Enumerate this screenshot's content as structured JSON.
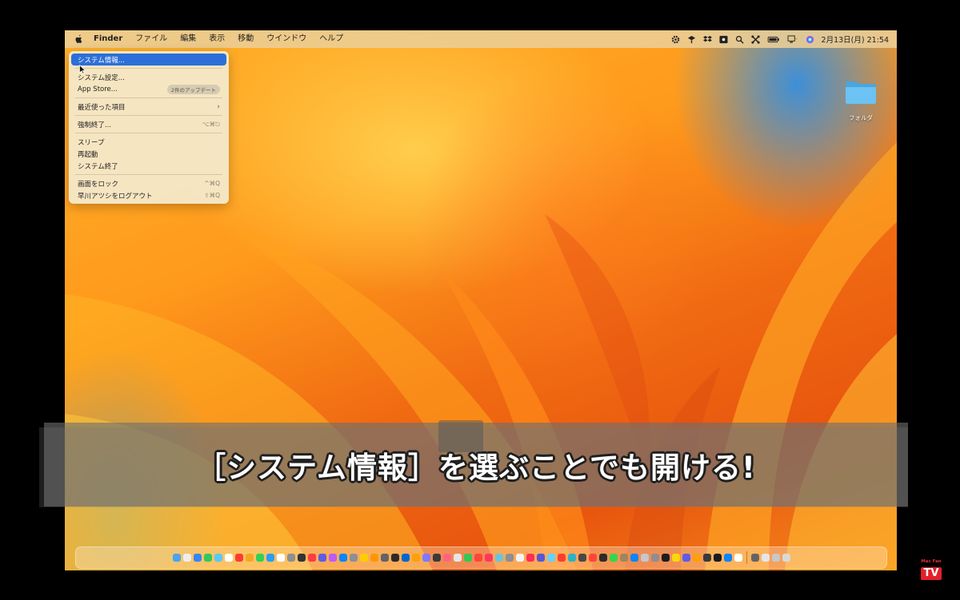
{
  "menubar": {
    "app_name": "Finder",
    "menus": [
      "ファイル",
      "編集",
      "表示",
      "移動",
      "ウインドウ",
      "ヘルプ"
    ],
    "clock": "2月13日(月)  21:54",
    "tray_icons": [
      "gear-icon",
      "network-icon",
      "dropbox-icon",
      "screen-record-icon",
      "search-icon",
      "control-center-icon",
      "battery-icon",
      "display-icon",
      "siri-icon"
    ]
  },
  "apple_menu": {
    "items": [
      {
        "label": "システム情報...",
        "highlighted": true
      },
      {
        "separator": true
      },
      {
        "label": "システム設定..."
      },
      {
        "label": "App Store...",
        "badge": "2件のアップデート"
      },
      {
        "separator": true
      },
      {
        "label": "最近使った項目",
        "submenu": true
      },
      {
        "separator": true
      },
      {
        "label": "強制終了...",
        "shortcut": "⌥⌘⎋"
      },
      {
        "separator": true
      },
      {
        "label": "スリープ"
      },
      {
        "label": "再起動"
      },
      {
        "label": "システム終了"
      },
      {
        "separator": true
      },
      {
        "label": "画面をロック",
        "shortcut": "^⌘Q"
      },
      {
        "label": "早川アツシをログアウト",
        "shortcut": "⇧⌘Q"
      }
    ]
  },
  "desktop": {
    "folder_label": "フォルダ"
  },
  "subtitle": "［システム情報］を選ぶことでも開ける!",
  "logo": {
    "small_text": "Mac Fan",
    "tv_text": "TV"
  },
  "colors": {
    "highlight": "#2d6fd8",
    "folder": "#5bb4ea",
    "logo_red": "#e41f2a"
  },
  "dock": {
    "app_colors": [
      "#4aa3f0",
      "#eeeeee",
      "#3b82f6",
      "#34c759",
      "#5ac8fa",
      "#ffffff",
      "#ff3b30",
      "#f5a623",
      "#30d158",
      "#2a9df4",
      "#ffffff",
      "#8e8e93",
      "#333333",
      "#fc3c44",
      "#5e5ce6",
      "#bf5af2",
      "#0a84ff",
      "#8e8e93",
      "#ffcc00",
      "#ff9500",
      "#636366",
      "#2b2b2b",
      "#0066cc",
      "#ff9f0a",
      "#7d7aff",
      "#3a3a3c",
      "#ff6482",
      "#e5e5ea",
      "#34c759",
      "#ff453a",
      "#ff375f",
      "#6ac4dc",
      "#8e8e93",
      "#f2f2f7",
      "#ff2d55",
      "#5856d6",
      "#64d2ff",
      "#ff3b30",
      "#30b0c7",
      "#48484a",
      "#ff453a",
      "#2c2c2e",
      "#32d74b",
      "#a2845e",
      "#0a84ff",
      "#c7c7cc",
      "#8e8e93",
      "#1c1c1e",
      "#ffd60a",
      "#5e5ce6",
      "#ff9f0a",
      "#3a3a3c",
      "#1c1c1e",
      "#0a84ff",
      "#ffffff",
      "#636366",
      "#e5e5ea",
      "#c7c7cc"
    ]
  }
}
